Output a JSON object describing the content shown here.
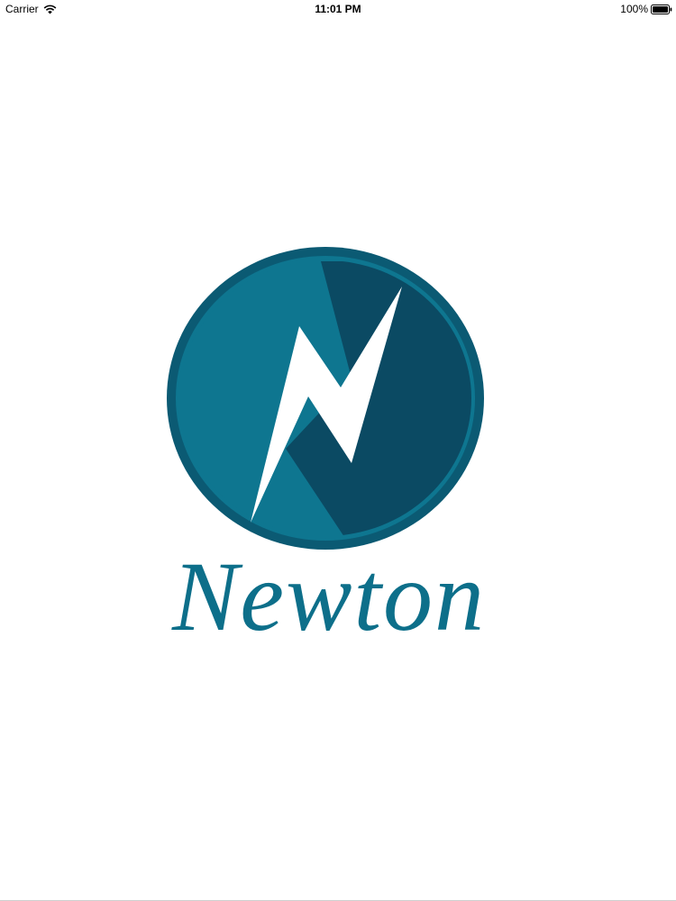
{
  "status_bar": {
    "carrier": "Carrier",
    "time": "11:01 PM",
    "battery_percent": "100%",
    "icons": {
      "wifi": "wifi-icon",
      "battery": "battery-icon"
    }
  },
  "splash": {
    "logo": {
      "icon_name": "lightning-bolt-logo",
      "colors": {
        "outer_ring": "#0b5a73",
        "inner_light": "#0e7690",
        "inner_dark": "#0b4a63",
        "bolt": "#ffffff"
      }
    },
    "app_name": "Newton",
    "app_name_color": "#0d6f8a"
  },
  "background_color": "#ffffff"
}
